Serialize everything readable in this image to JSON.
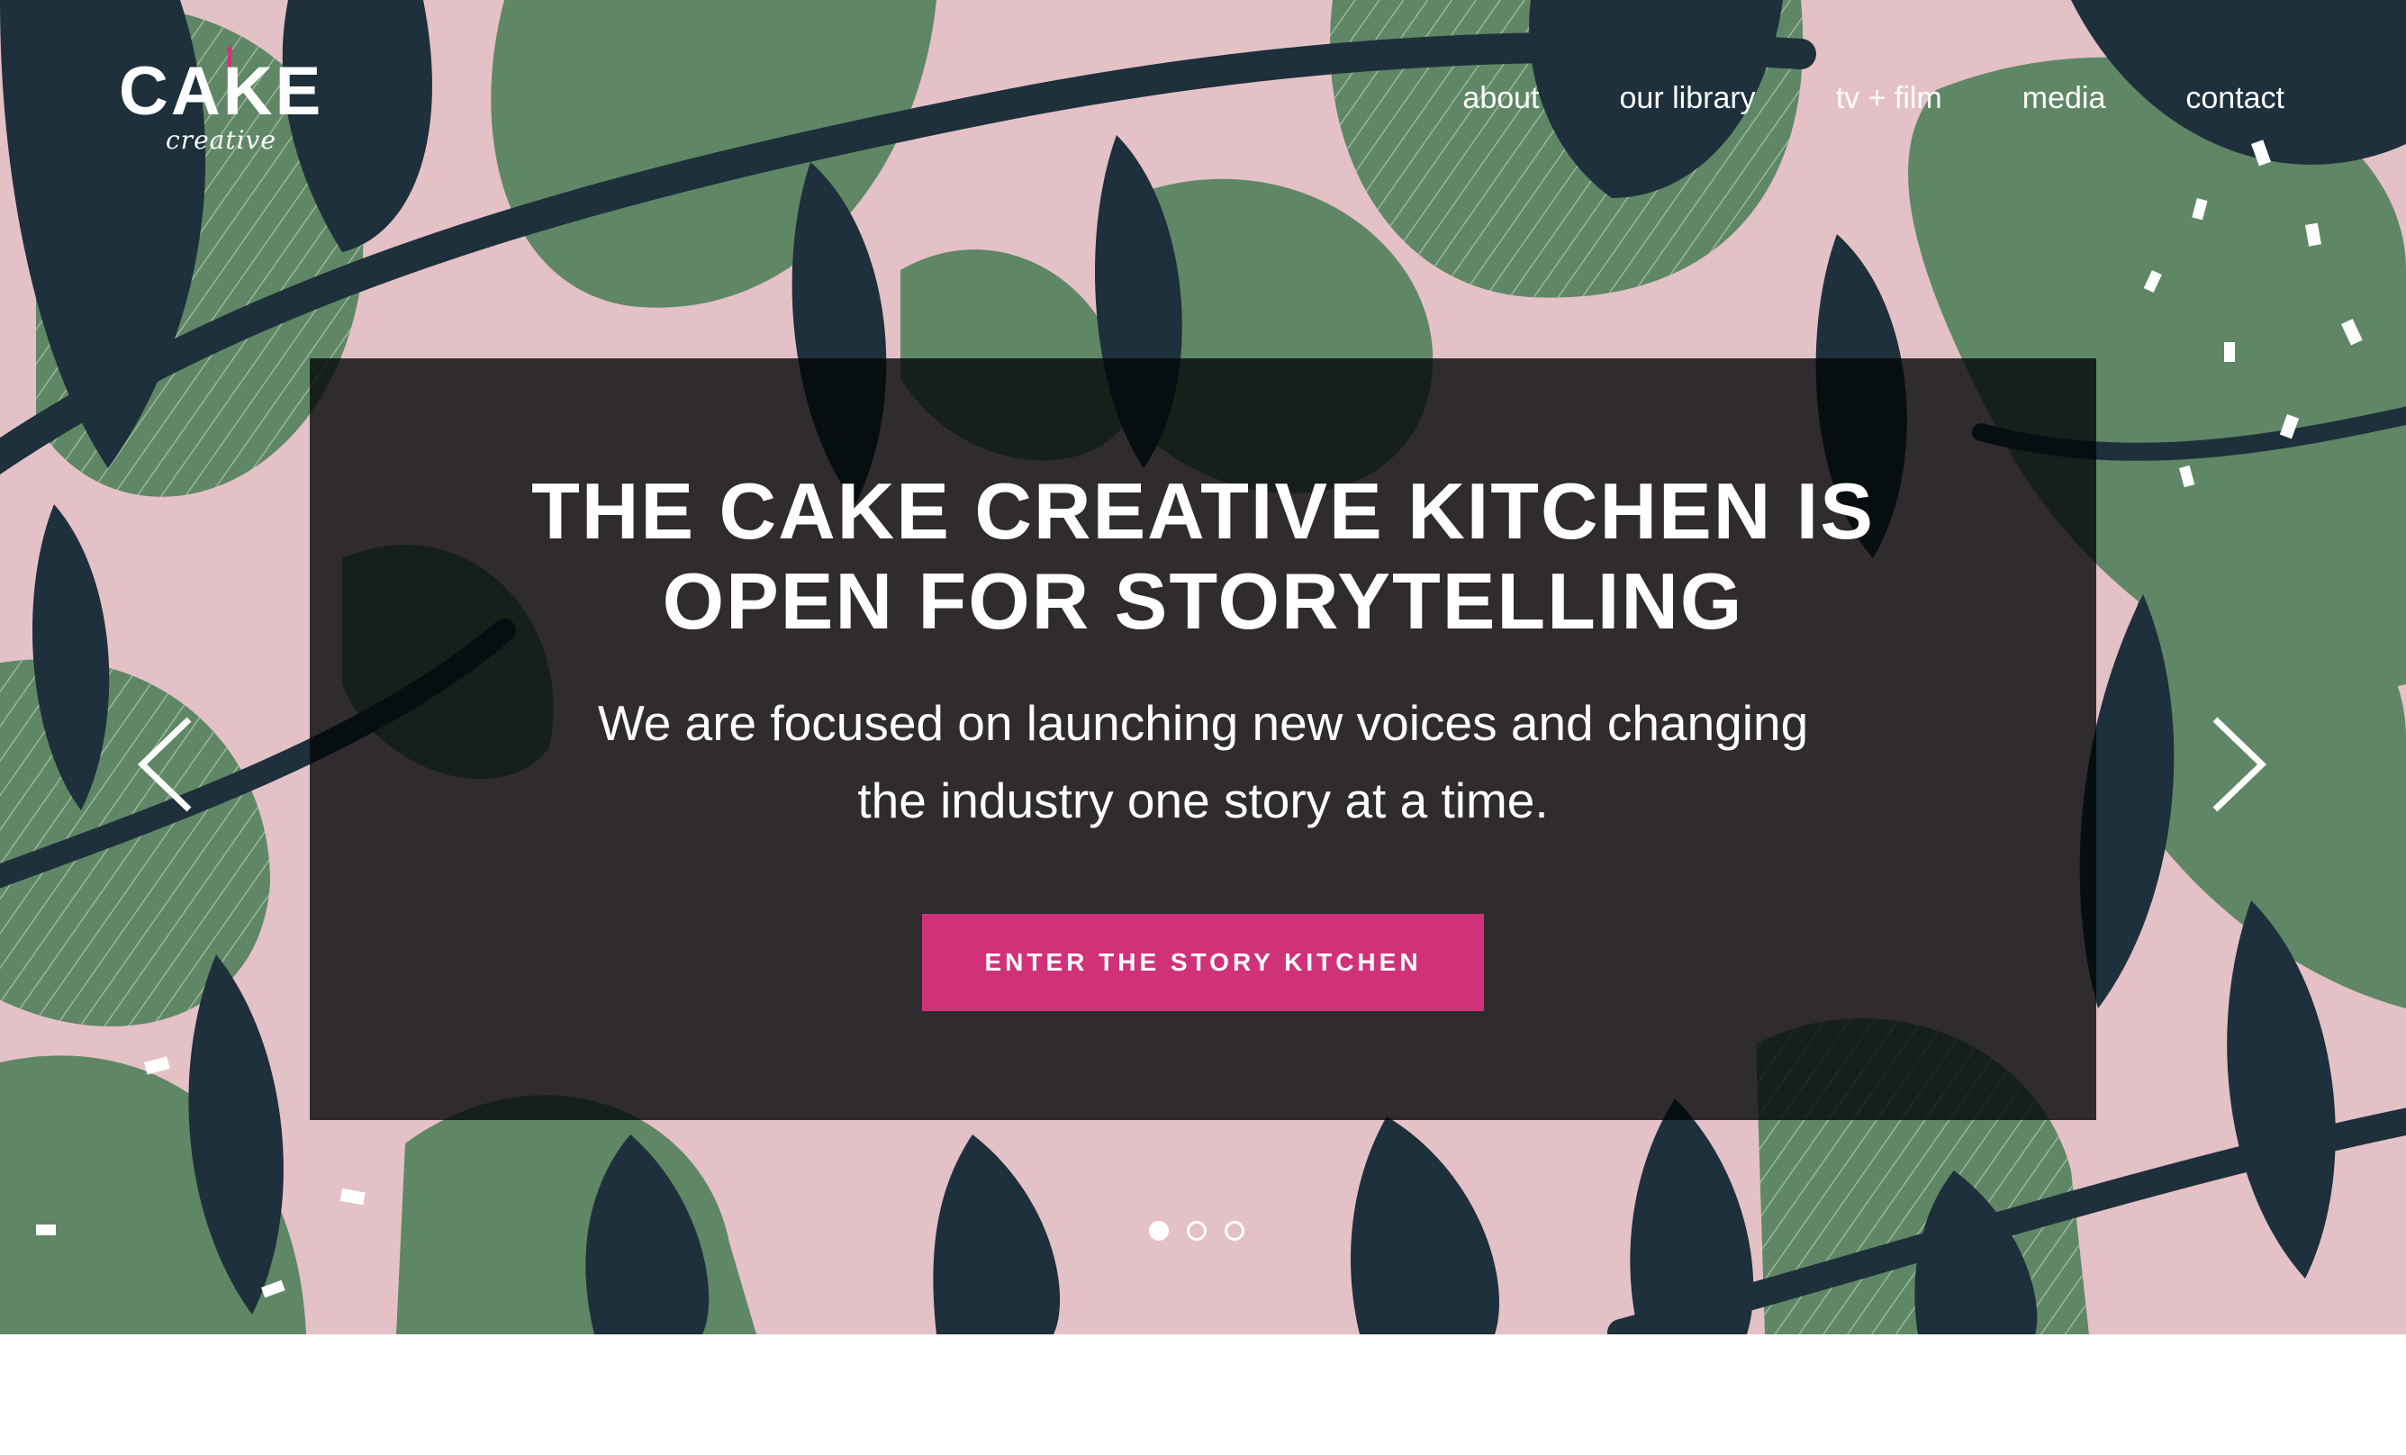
{
  "brand": {
    "logo_text": "CAKE",
    "logo_subtext": "creative",
    "accent_color": "#d0327a"
  },
  "nav": {
    "items": [
      {
        "label": "about"
      },
      {
        "label": "our library"
      },
      {
        "label": "tv + film"
      },
      {
        "label": "media"
      },
      {
        "label": "contact"
      }
    ]
  },
  "hero": {
    "background": {
      "pink": "#e4c1c6",
      "green": "#5f8765",
      "navy": "#1d303b"
    },
    "headline_line1": "THE CAKE CREATIVE KITCHEN IS",
    "headline_line2": "OPEN FOR STORYTELLING",
    "subtext_line1": "We are focused on launching new voices and changing",
    "subtext_line2": "the industry one story at a time.",
    "cta_label": "ENTER THE STORY KITCHEN",
    "prev_icon": "chevron-left-icon",
    "next_icon": "chevron-right-icon",
    "slides_total": 3,
    "active_slide": 1
  }
}
